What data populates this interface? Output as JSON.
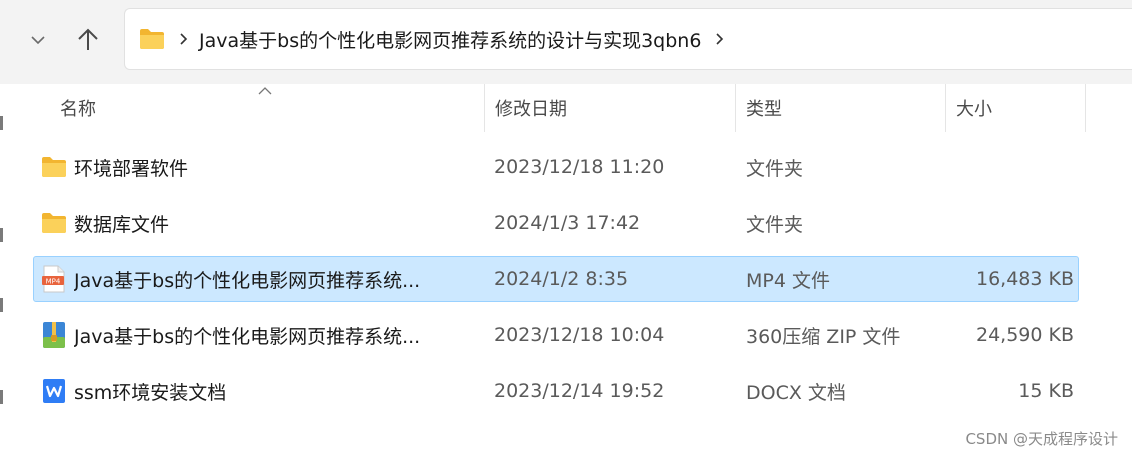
{
  "address": {
    "crumbs": [
      "Java基于bs的个性化电影网页推荐系统的设计与实现3qbn6"
    ]
  },
  "columns": {
    "name": "名称",
    "date": "修改日期",
    "type": "类型",
    "size": "大小"
  },
  "files": [
    {
      "icon": "folder-icon",
      "name": "环境部署软件",
      "date": "2023/12/18 11:20",
      "type": "文件夹",
      "size": ""
    },
    {
      "icon": "folder-icon",
      "name": "数据库文件",
      "date": "2024/1/3 17:42",
      "type": "文件夹",
      "size": ""
    },
    {
      "icon": "mp4-file-icon",
      "name": "Java基于bs的个性化电影网页推荐系统...",
      "date": "2024/1/2 8:35",
      "type": "MP4 文件",
      "size": "16,483 KB",
      "icon_label": "MP4"
    },
    {
      "icon": "zip-archive-icon",
      "name": "Java基于bs的个性化电影网页推荐系统...",
      "date": "2023/12/18 10:04",
      "type": "360压缩 ZIP 文件",
      "size": "24,590 KB"
    },
    {
      "icon": "docx-file-icon",
      "name": "ssm环境安装文档",
      "date": "2023/12/14 19:52",
      "type": "DOCX 文档",
      "size": "15 KB"
    }
  ],
  "selected_index": 2,
  "watermark": "CSDN @天成程序设计",
  "colors": {
    "selection_bg": "#cce8ff",
    "selection_border": "#99d1ff",
    "folder_yellow": "#f8c53a"
  }
}
